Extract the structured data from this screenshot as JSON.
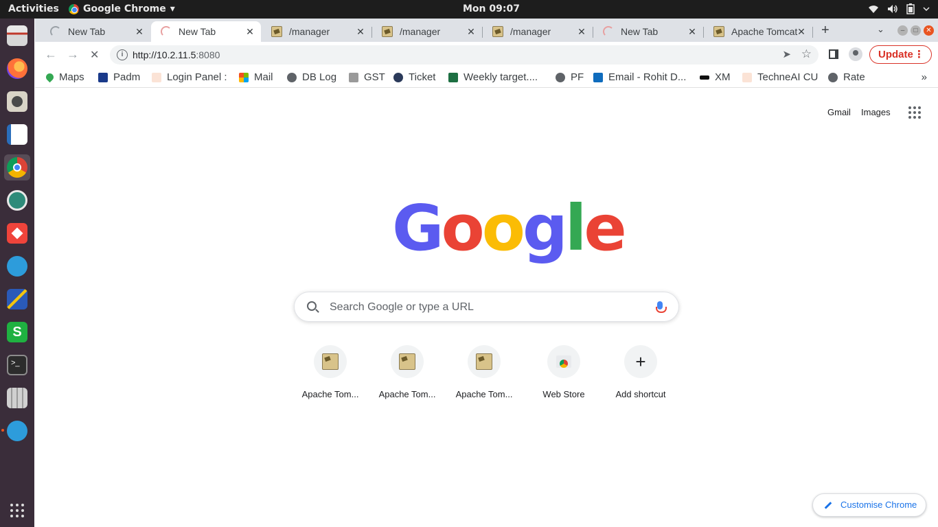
{
  "system_bar": {
    "activities": "Activities",
    "app_name": "Google Chrome",
    "app_menu_arrow": "▾",
    "clock": "Mon 09:07",
    "tray_icons": [
      "wifi-icon",
      "volume-icon",
      "battery-icon",
      "chevron-down-icon"
    ]
  },
  "dock": {
    "items": [
      "files",
      "firefox",
      "rhythmbox",
      "libreoffice-writer",
      "chrome",
      "app-green",
      "anydesk",
      "phone",
      "network-tool",
      "app-s",
      "terminal",
      "calculator",
      "phone-2",
      "show-apps"
    ]
  },
  "tabs": [
    {
      "title": "New Tab",
      "icon": "spinner-icon",
      "active": false
    },
    {
      "title": "New Tab",
      "icon": "spinner-icon",
      "active": true
    },
    {
      "title": "/manager",
      "icon": "tomcat-icon",
      "active": false
    },
    {
      "title": "/manager",
      "icon": "tomcat-icon",
      "active": false
    },
    {
      "title": "/manager",
      "icon": "tomcat-icon",
      "active": false
    },
    {
      "title": "New Tab",
      "icon": "spinner-icon",
      "active": false
    },
    {
      "title": "Apache Tomcat",
      "icon": "tomcat-icon",
      "active": false
    }
  ],
  "tab_close": "✕",
  "new_tab": "+",
  "tab_search": "⌄",
  "window_controls": {
    "minimize": "–",
    "maximize": "□",
    "close": "✕"
  },
  "toolbar": {
    "back": "←",
    "forward": "→",
    "reload": "✕",
    "info": "i",
    "url_host": "http://10.2.11.5",
    "url_port": ":8080",
    "send": "➤",
    "star": "☆",
    "update_label": "Update",
    "menu": "⋮"
  },
  "bookmarks": [
    {
      "label": "Maps",
      "icon": "maps-icon",
      "color": "#34a853"
    },
    {
      "label": "Padm",
      "icon": "padm-icon",
      "color": "#1a3a8a"
    },
    {
      "label": "Login Panel :",
      "icon": "login-icon",
      "color": "#f0b090"
    },
    {
      "label": "Mail",
      "icon": "mail-icon",
      "color": "#f25022"
    },
    {
      "label": "DB Log",
      "icon": "globe-icon",
      "color": "#5f6368"
    },
    {
      "label": "GST",
      "icon": "gst-icon",
      "color": "#9a9a9a"
    },
    {
      "label": "Ticket",
      "icon": "ticket-icon",
      "color": "#2b3a5a"
    },
    {
      "label": "Weekly target....",
      "icon": "excel-icon",
      "color": "#1d6f42"
    },
    {
      "label": "PF",
      "icon": "globe-icon",
      "color": "#5f6368"
    },
    {
      "label": "Email - Rohit D...",
      "icon": "outlook-icon",
      "color": "#0f6cbd"
    },
    {
      "label": "XM",
      "icon": "xm-icon",
      "color": "#111111"
    },
    {
      "label": "TechneAI CU",
      "icon": "techne-icon",
      "color": "#f0b090"
    },
    {
      "label": "Rate",
      "icon": "globe-icon",
      "color": "#5f6368"
    }
  ],
  "bookmarks_more": "»",
  "ntp": {
    "gmail": "Gmail",
    "images": "Images",
    "logo_letters": [
      "G",
      "o",
      "o",
      "g",
      "l",
      "e"
    ],
    "logo_colors": [
      "#5b5bf0",
      "#ea4335",
      "#fbbc05",
      "#5b5bf0",
      "#34a853",
      "#ea4335"
    ],
    "search_placeholder": "Search Google or type a URL",
    "shortcuts": [
      {
        "label": "Apache Tom...",
        "icon": "tomcat-icon"
      },
      {
        "label": "Apache Tom...",
        "icon": "tomcat-icon"
      },
      {
        "label": "Apache Tom...",
        "icon": "tomcat-icon"
      },
      {
        "label": "Web Store",
        "icon": "webstore-icon"
      },
      {
        "label": "Add shortcut",
        "icon": "plus-icon"
      }
    ],
    "customise": "Customise Chrome"
  }
}
